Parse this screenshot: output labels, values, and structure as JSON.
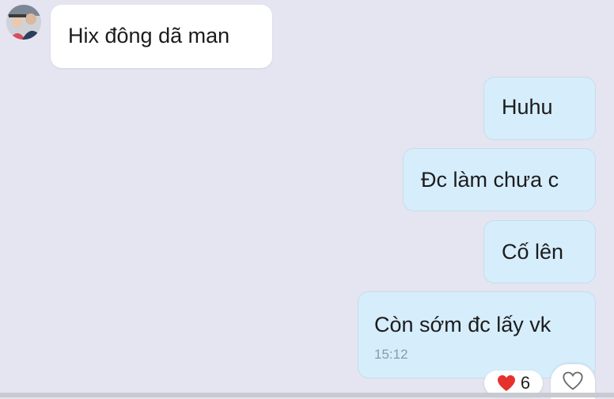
{
  "messages": [
    {
      "sender": "other",
      "text": "Hix đông dã man"
    },
    {
      "sender": "me",
      "text": "Huhu"
    },
    {
      "sender": "me",
      "text": "Đc làm chưa c"
    },
    {
      "sender": "me",
      "text": "Cố lên"
    },
    {
      "sender": "me",
      "text": "Còn sớm đc lấy vk",
      "time": "15:12"
    }
  ],
  "reaction": {
    "icon": "heart-icon",
    "count": "6",
    "color": "#e5322d"
  },
  "like_button": {
    "icon": "heart-outline-icon"
  },
  "colors": {
    "background": "#e4e5f0",
    "incoming_bubble": "#ffffff",
    "outgoing_bubble": "#d6edfb",
    "timestamp": "#8a9aa6"
  }
}
